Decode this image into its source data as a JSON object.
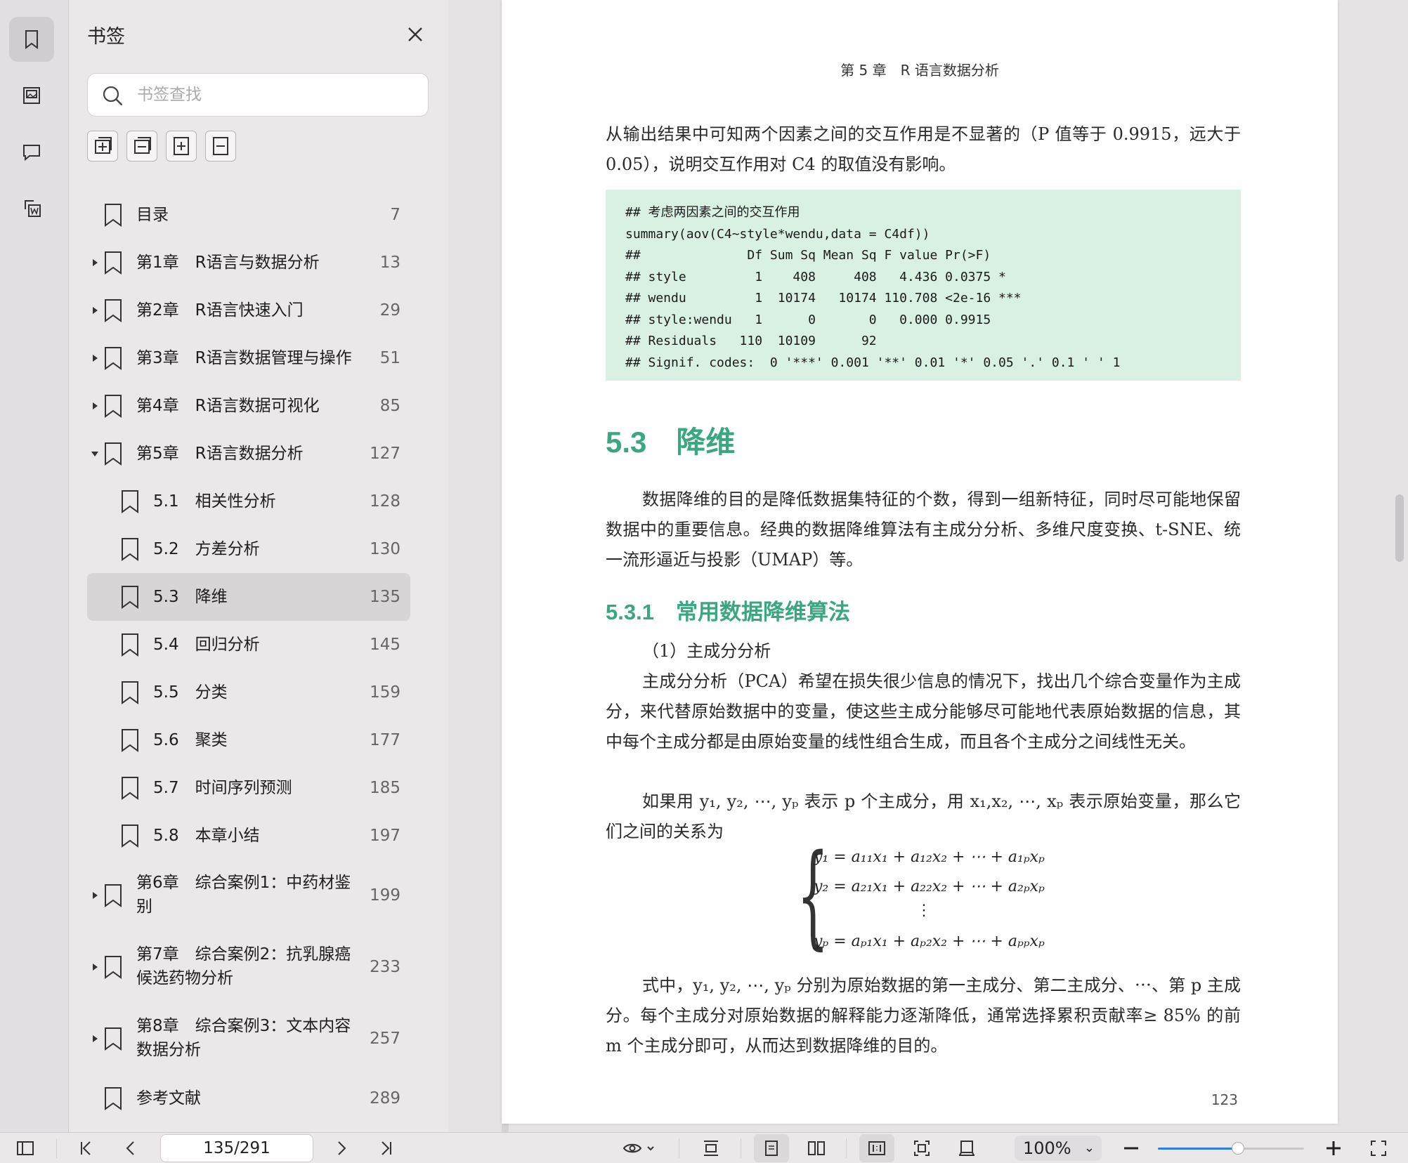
{
  "sidebar": {
    "title": "书签",
    "search_placeholder": "书签查找",
    "items": [
      {
        "label": "目录",
        "page": "7",
        "level": 0,
        "arrow": "none"
      },
      {
        "label": "第1章　R语言与数据分析",
        "page": "13",
        "level": 0,
        "arrow": "right"
      },
      {
        "label": "第2章　R语言快速入门",
        "page": "29",
        "level": 0,
        "arrow": "right"
      },
      {
        "label": "第3章　R语言数据管理与操作",
        "page": "51",
        "level": 0,
        "arrow": "right"
      },
      {
        "label": "第4章　R语言数据可视化",
        "page": "85",
        "level": 0,
        "arrow": "right"
      },
      {
        "label": "第5章　R语言数据分析",
        "page": "127",
        "level": 0,
        "arrow": "down"
      },
      {
        "label": "5.1　相关性分析",
        "page": "128",
        "level": 1,
        "arrow": "none"
      },
      {
        "label": "5.2　方差分析",
        "page": "130",
        "level": 1,
        "arrow": "none"
      },
      {
        "label": "5.3　降维",
        "page": "135",
        "level": 1,
        "arrow": "none",
        "selected": true
      },
      {
        "label": "5.4　回归分析",
        "page": "145",
        "level": 1,
        "arrow": "none"
      },
      {
        "label": "5.5　分类",
        "page": "159",
        "level": 1,
        "arrow": "none"
      },
      {
        "label": "5.6　聚类",
        "page": "177",
        "level": 1,
        "arrow": "none"
      },
      {
        "label": "5.7　时间序列预测",
        "page": "185",
        "level": 1,
        "arrow": "none"
      },
      {
        "label": "5.8　本章小结",
        "page": "197",
        "level": 1,
        "arrow": "none"
      },
      {
        "label": "第6章　综合案例1：中药材鉴别",
        "page": "199",
        "level": 0,
        "arrow": "right",
        "wrap": true
      },
      {
        "label": "第7章　综合案例2：抗乳腺癌候选药物分析",
        "page": "233",
        "level": 0,
        "arrow": "right",
        "wrap": true
      },
      {
        "label": "第8章　综合案例3：文本内容数据分析",
        "page": "257",
        "level": 0,
        "arrow": "right",
        "wrap": true
      },
      {
        "label": "参考文献",
        "page": "289",
        "level": 0,
        "arrow": "none"
      }
    ]
  },
  "document": {
    "header": "第 5 章　R 语言数据分析",
    "para1": "从输出结果中可知两个因素之间的交互作用是不显著的（P 值等于 0.9915，远大于 0.05），说明交互作用对 C4 的取值没有影响。",
    "code": "## 考虑两因素之间的交互作用\nsummary(aov(C4~style*wendu,data = C4df))\n##              Df Sum Sq Mean Sq F value Pr(>F)\n## style         1    408     408   4.436 0.0375 *\n## wendu         1  10174   10174 110.708 <2e-16 ***\n## style:wendu   1      0       0   0.000 0.9915\n## Residuals   110  10109      92\n## Signif. codes:  0 '***' 0.001 '**' 0.01 '*' 0.05 '.' 0.1 ' ' 1",
    "section_title": "5.3　降维",
    "para2": "数据降维的目的是降低数据集特征的个数，得到一组新特征，同时尽可能地保留数据中的重要信息。经典的数据降维算法有主成分分析、多维尺度变换、t-SNE、统一流形逼近与投影（UMAP）等。",
    "subsection_title": "5.3.1　常用数据降维算法",
    "item1": "（1）主成分分析",
    "para3": "主成分分析（PCA）希望在损失很少信息的情况下，找出几个综合变量作为主成分，来代替原始数据中的变量，使这些主成分能够尽可能地代表原始数据的信息，其中每个主成分都是由原始变量的线性组合生成，而且各个主成分之间线性无关。",
    "para4": "如果用 y₁, y₂, ⋯, yₚ 表示 p 个主成分，用 x₁,x₂, ⋯, xₚ 表示原始变量，那么它们之间的关系为",
    "formula": [
      "y₁ = a₁₁x₁ + a₁₂x₂ + ⋯ + a₁ₚxₚ",
      "y₂ = a₂₁x₁ + a₂₂x₂ + ⋯ + a₂ₚxₚ",
      "⋮",
      "yₚ = aₚ₁x₁ + aₚ₂x₂ + ⋯ + aₚₚxₚ"
    ],
    "para5": "式中，y₁, y₂, ⋯, yₚ 分别为原始数据的第一主成分、第二主成分、⋯、第 p 主成分。每个主成分对原始数据的解释能力逐渐降低，通常选择累积贡献率≥ 85% 的前 m 个主成分即可，从而达到数据降维的目的。",
    "page_number": "123"
  },
  "bottombar": {
    "page_indicator": "135/291",
    "zoom": "100%",
    "zoom_slider_fraction": 0.55
  }
}
